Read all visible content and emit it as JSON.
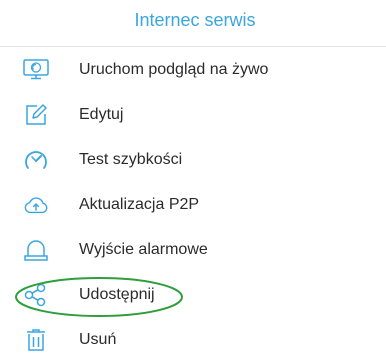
{
  "header": {
    "title": "Internec serwis"
  },
  "menu": {
    "items": [
      {
        "label": "Uruchom podgląd na żywo",
        "icon": "monitor-icon"
      },
      {
        "label": "Edytuj",
        "icon": "edit-icon"
      },
      {
        "label": "Test szybkości",
        "icon": "speedometer-icon"
      },
      {
        "label": "Aktualizacja P2P",
        "icon": "cloud-upload-icon"
      },
      {
        "label": "Wyjście alarmowe",
        "icon": "alarm-light-icon"
      },
      {
        "label": "Udostępnij",
        "icon": "share-icon"
      },
      {
        "label": "Usuń",
        "icon": "trash-icon"
      }
    ]
  },
  "colors": {
    "accent": "#3aa6e0",
    "highlight": "#2e9e3c",
    "text": "#2b2b2b"
  }
}
